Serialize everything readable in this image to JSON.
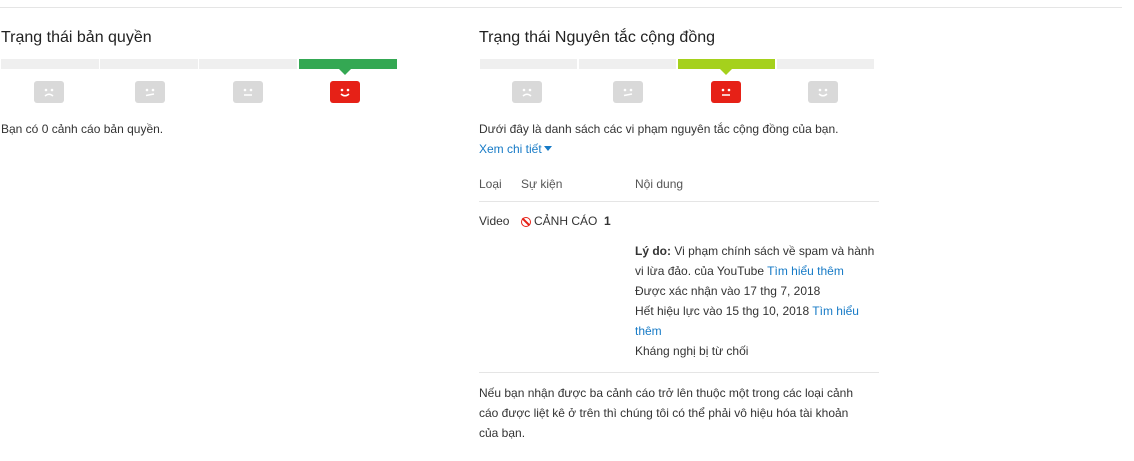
{
  "copyright": {
    "title": "Trạng thái bản quyền",
    "summary": "Bạn có 0 cảnh cáo bản quyền."
  },
  "community": {
    "title": "Trạng thái Nguyên tắc cộng đồng",
    "intro": "Dưới đây là danh sách các vi phạm nguyên tắc cộng đồng của bạn.",
    "see_details": "Xem chi tiết",
    "table": {
      "headers": [
        "Loại",
        "Sự kiện",
        "Nội dung"
      ],
      "row": {
        "type": "Video",
        "event": "CẢNH CÁO",
        "count": "1",
        "reason_label": "Lý do:",
        "reason_line1": "Vi phạm chính sách về spam và hành",
        "reason_line2": "vi lừa đảo. của YouTube",
        "learn_more": "Tìm hiểu thêm",
        "confirmed": "Được xác nhận vào 17 thg 7, 2018",
        "expires": "Hết hiệu lực vào 15 thg 10, 2018",
        "learn_more_split_1": "Tìm hiểu",
        "learn_more_split_2": "thêm",
        "appeal": "Kháng nghị bị từ chối"
      }
    },
    "warning_line1": "Nếu bạn nhận được ba cảnh cáo trở lên thuộc một trong các loại cảnh",
    "warning_line2": "cáo được liệt kê ở trên thì chúng tôi có thể phải vô hiệu hóa tài khoản",
    "warning_line3": "của bạn."
  },
  "colors": {
    "active_green": "#34a853",
    "active_lime": "#a5d11c",
    "red_face": "#e62117",
    "grey_face": "#d9d9d9",
    "link": "#167ac6"
  },
  "icons": [
    "sad-face-icon",
    "meh-face-icon",
    "smile-face-icon",
    "strike-icon",
    "caret-down-icon"
  ]
}
